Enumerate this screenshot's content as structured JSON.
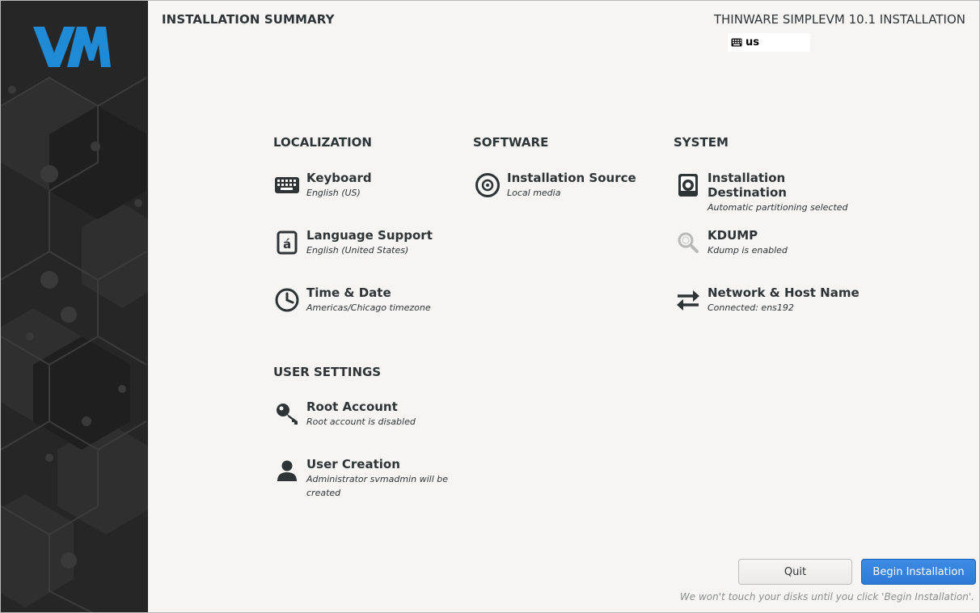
{
  "header": {
    "title": "INSTALLATION SUMMARY",
    "product": "THINWARE SIMPLEVM 10.1 INSTALLATION",
    "keyboard_layout": "us"
  },
  "logo": {
    "text": "VM",
    "color": "#1f8ad6"
  },
  "sections": {
    "localization": {
      "title": "LOCALIZATION",
      "items": [
        {
          "name": "Keyboard",
          "status": "English (US)",
          "icon": "keyboard-icon"
        },
        {
          "name": "Language Support",
          "status": "English (United States)",
          "icon": "language-icon"
        },
        {
          "name": "Time & Date",
          "status": "Americas/Chicago timezone",
          "icon": "clock-icon"
        }
      ]
    },
    "software": {
      "title": "SOFTWARE",
      "items": [
        {
          "name": "Installation Source",
          "status": "Local media",
          "icon": "disc-icon"
        }
      ]
    },
    "system": {
      "title": "SYSTEM",
      "items": [
        {
          "name": "Installation Destination",
          "status": "Automatic partitioning selected",
          "icon": "drive-icon"
        },
        {
          "name": "KDUMP",
          "status": "Kdump is enabled",
          "icon": "magnifier-icon"
        },
        {
          "name": "Network & Host Name",
          "status": "Connected: ens192",
          "icon": "network-arrows-icon"
        }
      ]
    },
    "user_settings": {
      "title": "USER SETTINGS",
      "items": [
        {
          "name": "Root Account",
          "status": "Root account is disabled",
          "icon": "key-icon"
        },
        {
          "name": "User Creation",
          "status": "Administrator svmadmin will be created",
          "icon": "user-icon"
        }
      ]
    }
  },
  "buttons": {
    "quit": "Quit",
    "begin": "Begin Installation"
  },
  "footnote": "We won't touch your disks until you click 'Begin Installation'.",
  "colors": {
    "accent": "#3584e4",
    "sidebar": "#2a2a2a",
    "background": "#f6f5f4"
  }
}
